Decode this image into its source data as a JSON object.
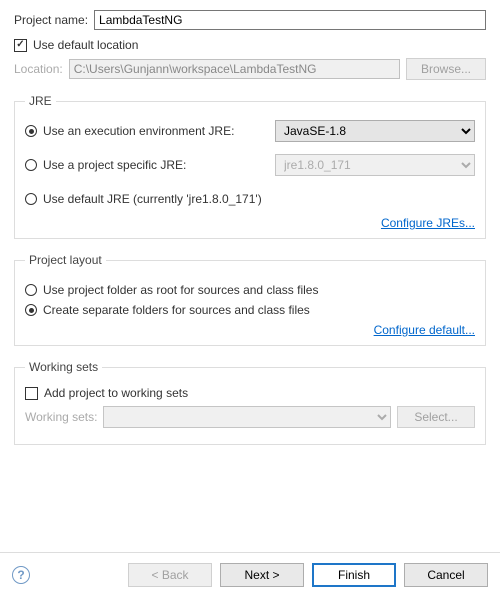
{
  "projectNameLabel": "Project name:",
  "projectNameValue": "LambdaTestNG",
  "useDefaultLocationLabel": "Use default location",
  "useDefaultLocationChecked": true,
  "locationLabel": "Location:",
  "locationValue": "C:\\Users\\Gunjann\\workspace\\LambdaTestNG",
  "browseLabel": "Browse...",
  "jre": {
    "legend": "JRE",
    "opt1": {
      "label": "Use an execution environment JRE:",
      "selected": true,
      "value": "JavaSE-1.8"
    },
    "opt2": {
      "label": "Use a project specific JRE:",
      "selected": false,
      "value": "jre1.8.0_171"
    },
    "opt3": {
      "label": "Use default JRE (currently 'jre1.8.0_171')",
      "selected": false
    },
    "configureLink": "Configure JREs..."
  },
  "layout": {
    "legend": "Project layout",
    "opt1": {
      "label": "Use project folder as root for sources and class files",
      "selected": false
    },
    "opt2": {
      "label": "Create separate folders for sources and class files",
      "selected": true
    },
    "configureLink": "Configure default..."
  },
  "workingSets": {
    "legend": "Working sets",
    "addLabel": "Add project to working sets",
    "addChecked": false,
    "fieldLabel": "Working sets:",
    "selectLabel": "Select..."
  },
  "footer": {
    "back": "< Back",
    "next": "Next >",
    "finish": "Finish",
    "cancel": "Cancel"
  }
}
